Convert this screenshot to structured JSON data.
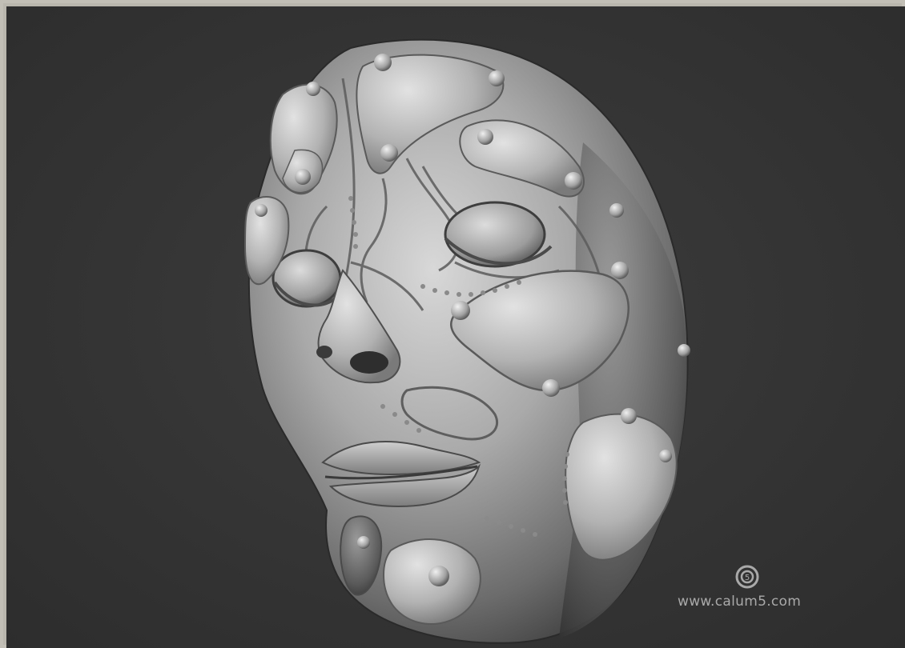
{
  "colors": {
    "background": "#343434",
    "frame": "#c2bfb6",
    "mask_light": "#d6d6d6",
    "mask_mid": "#8f8f8f",
    "mask_dark": "#4a4a4a",
    "watermark": "#a9a9a9"
  },
  "subject": "sculpted-biomechanical-face-mask",
  "watermark": {
    "logo_icon": "calum5-logo-icon",
    "text": "www.calum5.com"
  }
}
